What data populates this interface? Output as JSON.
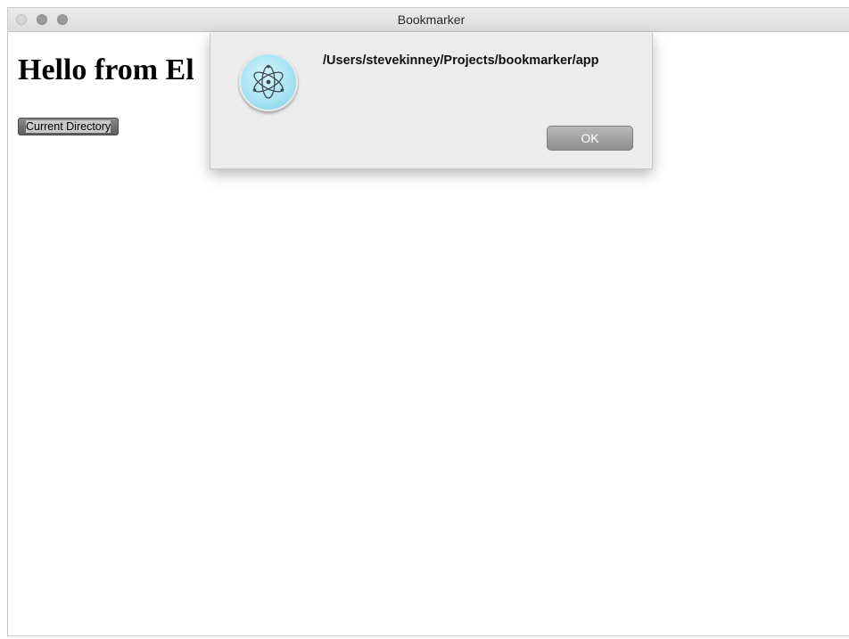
{
  "window": {
    "title": "Bookmarker"
  },
  "page": {
    "heading": "Hello from El",
    "current_directory_button": "Current Directory"
  },
  "dialog": {
    "icon": "electron-atom-icon",
    "message": "/Users/stevekinney/Projects/bookmarker/app",
    "ok_label": "OK"
  },
  "colors": {
    "dialog_background": "#ececec",
    "icon_accent": "#9fe1f1",
    "ok_button": "#9e9e9e"
  }
}
